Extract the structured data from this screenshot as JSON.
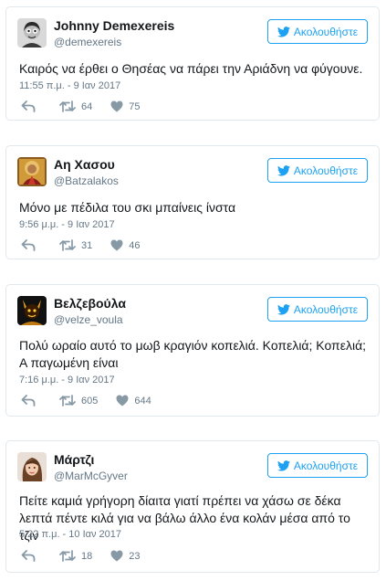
{
  "follow_label": "Ακολουθήστε",
  "tweets": [
    {
      "name": "Johnny Demexereis",
      "handle": "@demexereis",
      "text": "Καιρός να έρθει ο Θησέας να πάρει την Αριάδνη να φύγουνε.",
      "time": "11:55 π.μ. - 9 Ιαν 2017",
      "retweets": "64",
      "likes": "75"
    },
    {
      "name": "Αη Χασου",
      "handle": "@Batzalakos",
      "text": "Μόνο με πέδιλα του σκι μπαίνεις ίνστα",
      "time": "9:56 μ.μ. - 9 Ιαν 2017",
      "retweets": "31",
      "likes": "46"
    },
    {
      "name": "Βελζεβούλα",
      "handle": "@velze_voula",
      "text": "Πολύ ωραίο αυτό το μωβ κραγιόν κοπελιά. Κοπελιά; Κοπελιά; Α παγωμένη είναι",
      "time": "7:16 μ.μ. - 9 Ιαν 2017",
      "retweets": "605",
      "likes": "644"
    },
    {
      "name": "Μάρτζι",
      "handle": "@MarMcGyver",
      "text": "Πείτε καμιά γρήγορη δίαιτα γιατί πρέπει να χάσω σε δέκα λεπτά πέντε κιλά για να βάλω άλλο ένα κολάν μέσα από το τζιν",
      "time": "5:22 π.μ. - 10 Ιαν 2017",
      "retweets": "18",
      "likes": "23"
    }
  ],
  "colors": {
    "accent": "#1da1f2",
    "text": "#14171a",
    "muted": "#657786",
    "border": "#e1e8ed"
  }
}
